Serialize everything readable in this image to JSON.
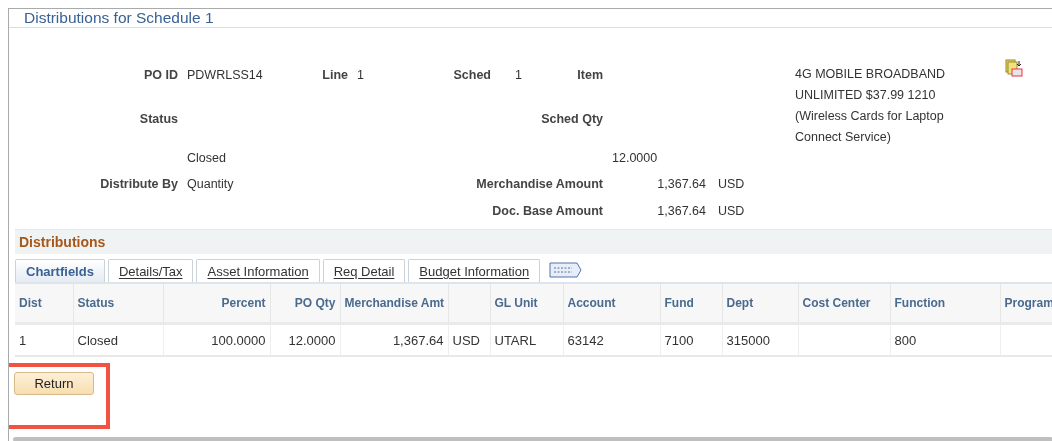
{
  "page": {
    "title": "Distributions for Schedule 1"
  },
  "header": {
    "po_id": {
      "label": "PO ID",
      "value": "PDWRLSS14"
    },
    "line": {
      "label": "Line",
      "value": "1"
    },
    "sched": {
      "label": "Sched",
      "value": "1"
    },
    "item": {
      "label": "Item",
      "description": "4G MOBILE BROADBAND UNLIMITED $37.99 1210 (Wireless Cards for Laptop Connect Service)"
    },
    "status": {
      "label": "Status",
      "value": "Closed"
    },
    "sched_qty": {
      "label": "Sched Qty",
      "value": "12.0000"
    },
    "distribute_by": {
      "label": "Distribute By",
      "value": "Quantity"
    },
    "merchandise_amount": {
      "label": "Merchandise Amount",
      "value": "1,367.64",
      "currency": "USD"
    },
    "doc_base_amount": {
      "label": "Doc. Base Amount",
      "value": "1,367.64",
      "currency": "USD"
    }
  },
  "distributions": {
    "title": "Distributions",
    "tabs": [
      {
        "label": "Chartfields",
        "selected": true
      },
      {
        "label": "Details/Tax",
        "selected": false
      },
      {
        "label": "Asset Information",
        "selected": false
      },
      {
        "label": "Req Detail",
        "selected": false
      },
      {
        "label": "Budget Information",
        "selected": false
      }
    ],
    "table": {
      "columns": [
        {
          "label": "Dist"
        },
        {
          "label": "Status"
        },
        {
          "label": "Percent"
        },
        {
          "label": "PO Qty"
        },
        {
          "label": "Merchandise Amt"
        },
        {},
        {
          "label": "GL Unit"
        },
        {
          "label": "Account"
        },
        {
          "label": "Fund"
        },
        {
          "label": "Dept"
        },
        {
          "label": "Cost Center"
        },
        {
          "label": "Function"
        },
        {
          "label": "Program"
        }
      ],
      "rows": [
        [
          "1",
          "Closed",
          "100.0000",
          "12.0000",
          "1,367.64",
          "USD",
          "UTARL",
          "63142",
          "7100",
          "315000",
          "",
          "800",
          ""
        ]
      ]
    }
  },
  "buttons": [
    {
      "label": "Return",
      "highlighted": true
    }
  ]
}
